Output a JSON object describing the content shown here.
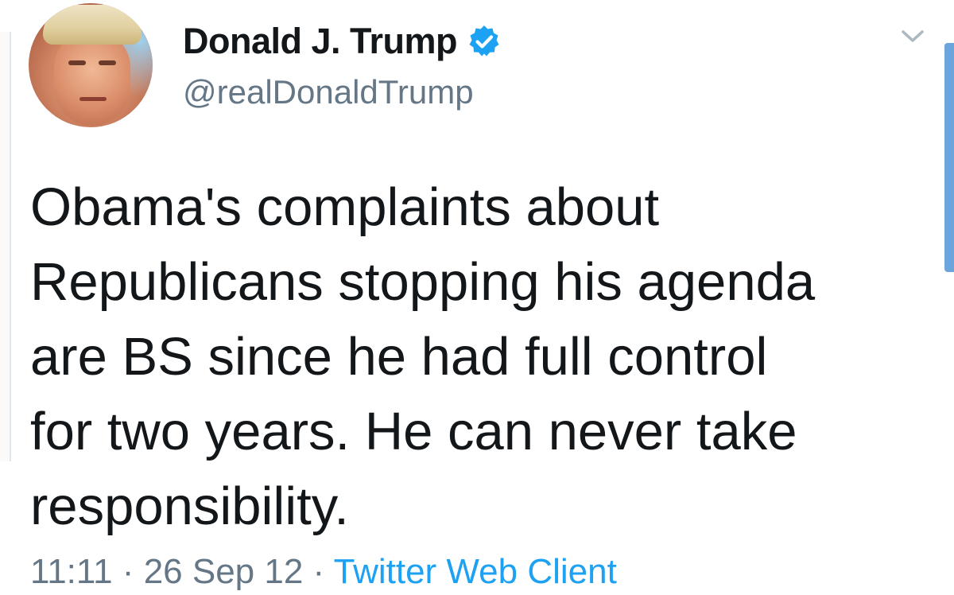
{
  "tweet": {
    "author": {
      "display_name": "Donald J. Trump",
      "handle": "@realDonaldTrump",
      "verified_icon": "verified-badge-icon",
      "verified_color": "#1da1f2"
    },
    "text": "Obama's complaints about\nRepublicans stopping his agenda\nare BS since he had full control\nfor two years. He can never take\nresponsibility.",
    "meta": {
      "time": "11:11",
      "separator1": " · ",
      "date": "26 Sep 12",
      "separator2": " · ",
      "source": "Twitter Web Client"
    },
    "menu_icon": "chevron-down-icon"
  },
  "colors": {
    "text": "#14171a",
    "secondary": "#657786",
    "link": "#1da1f2",
    "scrollbar": "#6ca4dc"
  }
}
